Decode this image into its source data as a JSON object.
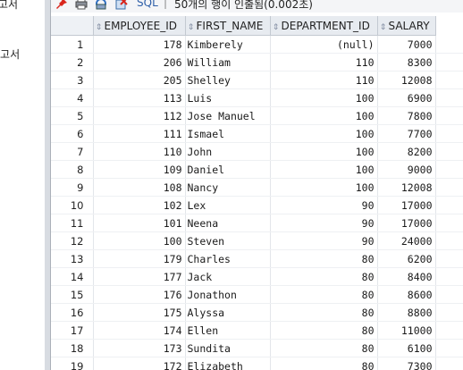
{
  "sidebar": {
    "items": [
      {
        "label": "고서"
      },
      {
        "label": "보고서"
      }
    ]
  },
  "toolbar": {
    "sql_label": "SQL",
    "status": "50개의 행이 인출됨(0.002초)"
  },
  "grid": {
    "columns": [
      "EMPLOYEE_ID",
      "FIRST_NAME",
      "DEPARTMENT_ID",
      "SALARY"
    ],
    "rows": [
      {
        "n": "1",
        "employee_id": "178",
        "first_name": "Kimberely",
        "department_id": "(null)",
        "salary": "7000"
      },
      {
        "n": "2",
        "employee_id": "206",
        "first_name": "William",
        "department_id": "110",
        "salary": "8300"
      },
      {
        "n": "3",
        "employee_id": "205",
        "first_name": "Shelley",
        "department_id": "110",
        "salary": "12008"
      },
      {
        "n": "4",
        "employee_id": "113",
        "first_name": "Luis",
        "department_id": "100",
        "salary": "6900"
      },
      {
        "n": "5",
        "employee_id": "112",
        "first_name": "Jose Manuel",
        "department_id": "100",
        "salary": "7800"
      },
      {
        "n": "6",
        "employee_id": "111",
        "first_name": "Ismael",
        "department_id": "100",
        "salary": "7700"
      },
      {
        "n": "7",
        "employee_id": "110",
        "first_name": "John",
        "department_id": "100",
        "salary": "8200"
      },
      {
        "n": "8",
        "employee_id": "109",
        "first_name": "Daniel",
        "department_id": "100",
        "salary": "9000"
      },
      {
        "n": "9",
        "employee_id": "108",
        "first_name": "Nancy",
        "department_id": "100",
        "salary": "12008"
      },
      {
        "n": "10",
        "employee_id": "102",
        "first_name": "Lex",
        "department_id": "90",
        "salary": "17000"
      },
      {
        "n": "11",
        "employee_id": "101",
        "first_name": "Neena",
        "department_id": "90",
        "salary": "17000"
      },
      {
        "n": "12",
        "employee_id": "100",
        "first_name": "Steven",
        "department_id": "90",
        "salary": "24000"
      },
      {
        "n": "13",
        "employee_id": "179",
        "first_name": "Charles",
        "department_id": "80",
        "salary": "6200"
      },
      {
        "n": "14",
        "employee_id": "177",
        "first_name": "Jack",
        "department_id": "80",
        "salary": "8400"
      },
      {
        "n": "15",
        "employee_id": "176",
        "first_name": "Jonathon",
        "department_id": "80",
        "salary": "8600"
      },
      {
        "n": "16",
        "employee_id": "175",
        "first_name": "Alyssa",
        "department_id": "80",
        "salary": "8800"
      },
      {
        "n": "17",
        "employee_id": "174",
        "first_name": "Ellen",
        "department_id": "80",
        "salary": "11000"
      },
      {
        "n": "18",
        "employee_id": "173",
        "first_name": "Sundita",
        "department_id": "80",
        "salary": "6100"
      },
      {
        "n": "19",
        "employee_id": "172",
        "first_name": "Elizabeth",
        "department_id": "80",
        "salary": "7300"
      }
    ]
  },
  "icons": [
    "pin-icon",
    "print-icon",
    "refresh-icon",
    "export-icon"
  ],
  "colors": {
    "header_bg": "#e7ebf0",
    "sql_link": "#2d5ea8",
    "pin_red": "#d9261c"
  }
}
